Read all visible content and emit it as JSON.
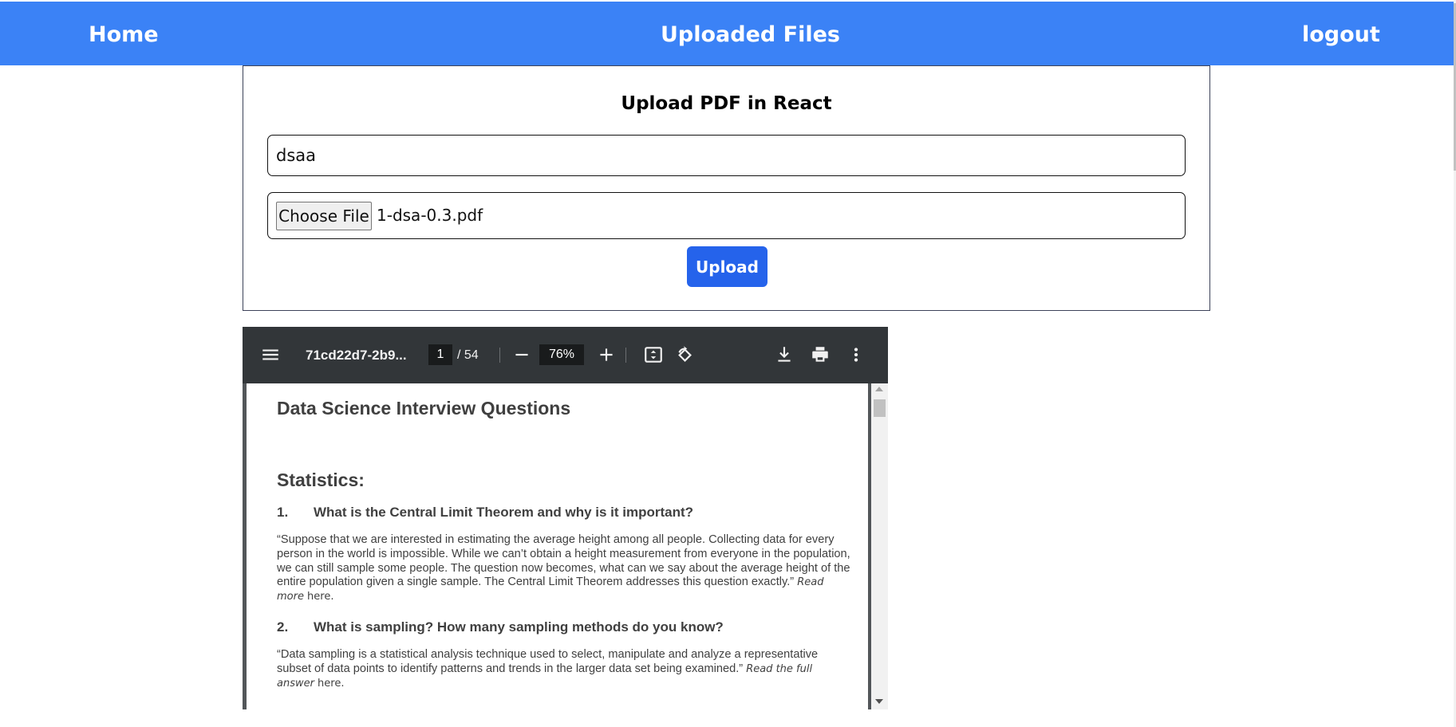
{
  "nav": {
    "home": "Home",
    "uploaded_files": "Uploaded Files",
    "logout": "logout"
  },
  "upload_form": {
    "title": "Upload PDF in React",
    "title_input_value": "dsaa",
    "choose_file_label": "Choose File",
    "chosen_file_name": "1-dsa-0.3.pdf",
    "upload_button": "Upload"
  },
  "pdf_viewer": {
    "document_title": "71cd22d7-2b9...",
    "current_page": "1",
    "total_pages": "/ 54",
    "zoom": "76%",
    "icons": [
      "menu-icon",
      "zoom-out-icon",
      "zoom-in-icon",
      "fit-page-icon",
      "rotate-icon",
      "download-icon",
      "print-icon",
      "more-options-icon"
    ],
    "content": {
      "heading": "Data Science Interview Questions",
      "section": "Statistics:",
      "q1_number": "1.",
      "q1_text": "What is the Central Limit Theorem and why is it important?",
      "q1_answer": "“Suppose that we are interested in estimating the average height among all people. Collecting data for every person in the world is impossible. While we can’t obtain a height measurement from everyone in the population, we can still sample some people. The question now becomes, what can we say about the average height of the entire population given a single sample. The Central Limit Theorem addresses this question exactly.”",
      "q1_read_more": "Read more",
      "q1_here": "here.",
      "q2_number": "2.",
      "q2_text": "What is sampling? How many sampling methods do you know?",
      "q2_answer": "“Data sampling is a statistical analysis technique used to select, manipulate and analyze a representative subset of data points to identify patterns and trends in the larger data set being examined.”",
      "q2_read_full": "Read the full answer",
      "q2_here": "here."
    }
  },
  "colors": {
    "navbar": "#3b82f6",
    "upload_button": "#2563eb",
    "viewer_toolbar": "#323639",
    "viewer_background": "#525659"
  }
}
